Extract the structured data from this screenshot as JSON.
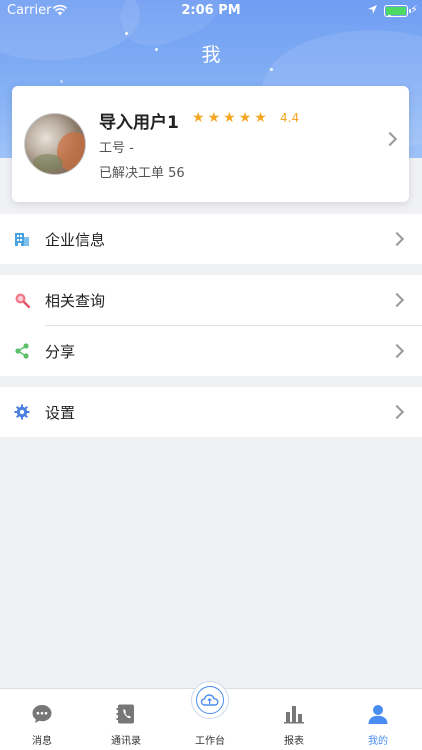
{
  "status_bar": {
    "carrier": "Carrier",
    "time": "2:06 PM"
  },
  "header": {
    "title": "我"
  },
  "profile": {
    "name": "导入用户1",
    "rating": "4.4",
    "rating_stars": 4.5,
    "employee_id": "工号 -",
    "resolved": "已解决工单 56"
  },
  "menu": {
    "company_info": "企业信息",
    "query": "相关查询",
    "share": "分享",
    "settings": "设置"
  },
  "tabs": [
    {
      "label": "消息",
      "icon": "message-icon"
    },
    {
      "label": "通讯录",
      "icon": "contacts-icon"
    },
    {
      "label": "工作台",
      "icon": "cloud-icon"
    },
    {
      "label": "报表",
      "icon": "chart-icon"
    },
    {
      "label": "我的",
      "icon": "user-icon"
    }
  ],
  "colors": {
    "accent": "#4a8df0",
    "star": "#f5a623",
    "header": "#7ea8f3"
  }
}
